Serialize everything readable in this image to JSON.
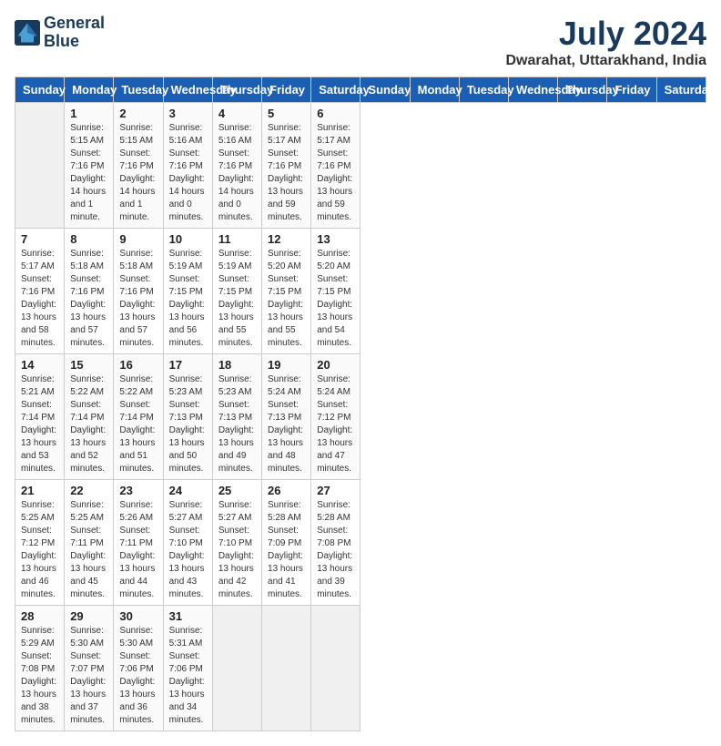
{
  "logo": {
    "name1": "General",
    "name2": "Blue"
  },
  "title": "July 2024",
  "location": "Dwarahat, Uttarakhand, India",
  "days_of_week": [
    "Sunday",
    "Monday",
    "Tuesday",
    "Wednesday",
    "Thursday",
    "Friday",
    "Saturday"
  ],
  "weeks": [
    [
      {
        "day": "",
        "empty": true
      },
      {
        "day": "1",
        "sunrise": "5:15 AM",
        "sunset": "7:16 PM",
        "daylight": "14 hours and 1 minute."
      },
      {
        "day": "2",
        "sunrise": "5:15 AM",
        "sunset": "7:16 PM",
        "daylight": "14 hours and 1 minute."
      },
      {
        "day": "3",
        "sunrise": "5:16 AM",
        "sunset": "7:16 PM",
        "daylight": "14 hours and 0 minutes."
      },
      {
        "day": "4",
        "sunrise": "5:16 AM",
        "sunset": "7:16 PM",
        "daylight": "14 hours and 0 minutes."
      },
      {
        "day": "5",
        "sunrise": "5:17 AM",
        "sunset": "7:16 PM",
        "daylight": "13 hours and 59 minutes."
      },
      {
        "day": "6",
        "sunrise": "5:17 AM",
        "sunset": "7:16 PM",
        "daylight": "13 hours and 59 minutes."
      }
    ],
    [
      {
        "day": "7",
        "sunrise": "5:17 AM",
        "sunset": "7:16 PM",
        "daylight": "13 hours and 58 minutes."
      },
      {
        "day": "8",
        "sunrise": "5:18 AM",
        "sunset": "7:16 PM",
        "daylight": "13 hours and 57 minutes."
      },
      {
        "day": "9",
        "sunrise": "5:18 AM",
        "sunset": "7:16 PM",
        "daylight": "13 hours and 57 minutes."
      },
      {
        "day": "10",
        "sunrise": "5:19 AM",
        "sunset": "7:15 PM",
        "daylight": "13 hours and 56 minutes."
      },
      {
        "day": "11",
        "sunrise": "5:19 AM",
        "sunset": "7:15 PM",
        "daylight": "13 hours and 55 minutes."
      },
      {
        "day": "12",
        "sunrise": "5:20 AM",
        "sunset": "7:15 PM",
        "daylight": "13 hours and 55 minutes."
      },
      {
        "day": "13",
        "sunrise": "5:20 AM",
        "sunset": "7:15 PM",
        "daylight": "13 hours and 54 minutes."
      }
    ],
    [
      {
        "day": "14",
        "sunrise": "5:21 AM",
        "sunset": "7:14 PM",
        "daylight": "13 hours and 53 minutes."
      },
      {
        "day": "15",
        "sunrise": "5:22 AM",
        "sunset": "7:14 PM",
        "daylight": "13 hours and 52 minutes."
      },
      {
        "day": "16",
        "sunrise": "5:22 AM",
        "sunset": "7:14 PM",
        "daylight": "13 hours and 51 minutes."
      },
      {
        "day": "17",
        "sunrise": "5:23 AM",
        "sunset": "7:13 PM",
        "daylight": "13 hours and 50 minutes."
      },
      {
        "day": "18",
        "sunrise": "5:23 AM",
        "sunset": "7:13 PM",
        "daylight": "13 hours and 49 minutes."
      },
      {
        "day": "19",
        "sunrise": "5:24 AM",
        "sunset": "7:13 PM",
        "daylight": "13 hours and 48 minutes."
      },
      {
        "day": "20",
        "sunrise": "5:24 AM",
        "sunset": "7:12 PM",
        "daylight": "13 hours and 47 minutes."
      }
    ],
    [
      {
        "day": "21",
        "sunrise": "5:25 AM",
        "sunset": "7:12 PM",
        "daylight": "13 hours and 46 minutes."
      },
      {
        "day": "22",
        "sunrise": "5:25 AM",
        "sunset": "7:11 PM",
        "daylight": "13 hours and 45 minutes."
      },
      {
        "day": "23",
        "sunrise": "5:26 AM",
        "sunset": "7:11 PM",
        "daylight": "13 hours and 44 minutes."
      },
      {
        "day": "24",
        "sunrise": "5:27 AM",
        "sunset": "7:10 PM",
        "daylight": "13 hours and 43 minutes."
      },
      {
        "day": "25",
        "sunrise": "5:27 AM",
        "sunset": "7:10 PM",
        "daylight": "13 hours and 42 minutes."
      },
      {
        "day": "26",
        "sunrise": "5:28 AM",
        "sunset": "7:09 PM",
        "daylight": "13 hours and 41 minutes."
      },
      {
        "day": "27",
        "sunrise": "5:28 AM",
        "sunset": "7:08 PM",
        "daylight": "13 hours and 39 minutes."
      }
    ],
    [
      {
        "day": "28",
        "sunrise": "5:29 AM",
        "sunset": "7:08 PM",
        "daylight": "13 hours and 38 minutes."
      },
      {
        "day": "29",
        "sunrise": "5:30 AM",
        "sunset": "7:07 PM",
        "daylight": "13 hours and 37 minutes."
      },
      {
        "day": "30",
        "sunrise": "5:30 AM",
        "sunset": "7:06 PM",
        "daylight": "13 hours and 36 minutes."
      },
      {
        "day": "31",
        "sunrise": "5:31 AM",
        "sunset": "7:06 PM",
        "daylight": "13 hours and 34 minutes."
      },
      {
        "day": "",
        "empty": true
      },
      {
        "day": "",
        "empty": true
      },
      {
        "day": "",
        "empty": true
      }
    ]
  ]
}
